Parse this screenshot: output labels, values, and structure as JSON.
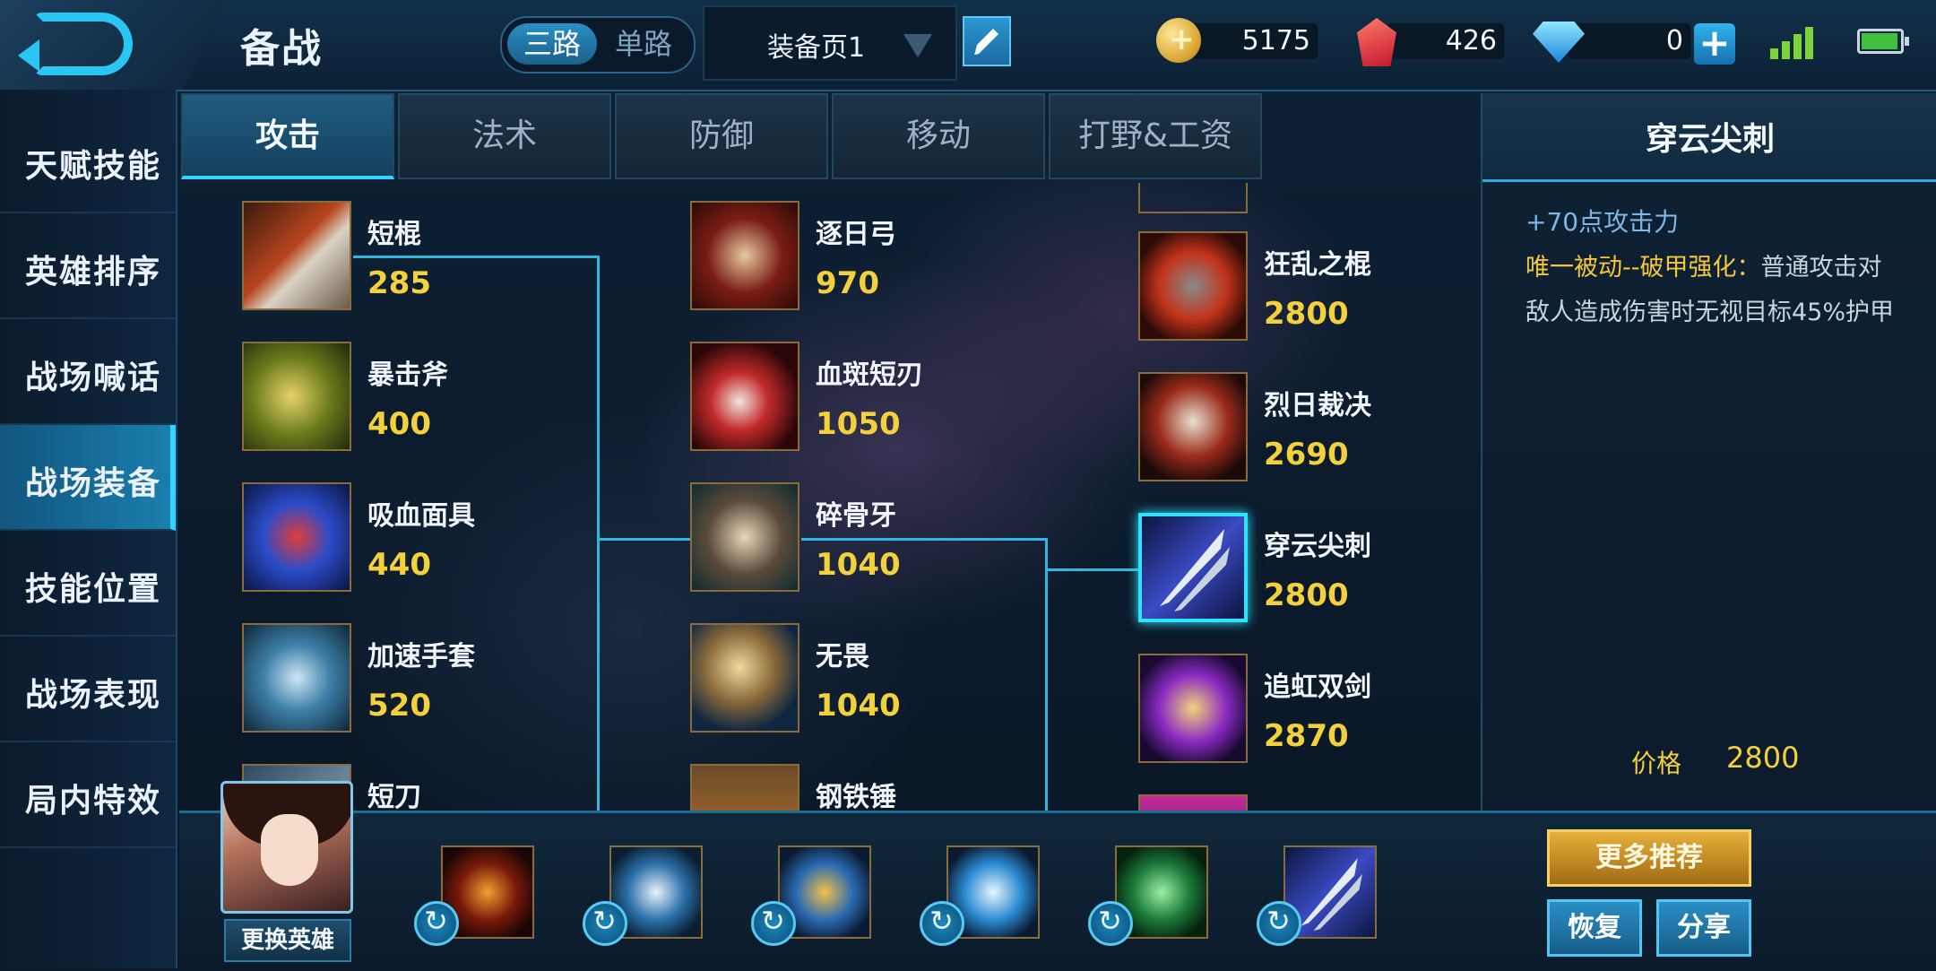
{
  "header": {
    "title": "备战",
    "mode_on": "三路",
    "mode_off": "单路",
    "equip_page": "装备页1",
    "gold": "5175",
    "crystal": "426",
    "diamond": "0"
  },
  "sidebar": {
    "items": [
      {
        "label": "天赋技能"
      },
      {
        "label": "英雄排序"
      },
      {
        "label": "战场喊话"
      },
      {
        "label": "战场装备"
      },
      {
        "label": "技能位置"
      },
      {
        "label": "战场表现"
      },
      {
        "label": "局内特效"
      }
    ],
    "active_index": 3
  },
  "tabs": [
    {
      "label": "攻击"
    },
    {
      "label": "法术"
    },
    {
      "label": "防御"
    },
    {
      "label": "移动"
    },
    {
      "label": "打野&工资"
    }
  ],
  "tree": {
    "col1": [
      {
        "name": "短棍",
        "price": "285"
      },
      {
        "name": "暴击斧",
        "price": "400"
      },
      {
        "name": "吸血面具",
        "price": "440"
      },
      {
        "name": "加速手套",
        "price": "520"
      },
      {
        "name": "短刀",
        "price": ""
      }
    ],
    "col2": [
      {
        "name": "逐日弓",
        "price": "970"
      },
      {
        "name": "血斑短刃",
        "price": "1050"
      },
      {
        "name": "碎骨牙",
        "price": "1040"
      },
      {
        "name": "无畏",
        "price": "1040"
      },
      {
        "name": "钢铁锤",
        "price": ""
      }
    ],
    "col3": [
      {
        "name": "狂乱之棍",
        "price": "2800"
      },
      {
        "name": "烈日裁决",
        "price": "2690"
      },
      {
        "name": "穿云尖刺",
        "price": "2800"
      },
      {
        "name": "追虹双剑",
        "price": "2870"
      }
    ]
  },
  "detail": {
    "title": "穿云尖刺",
    "stat": "+70点攻击力",
    "passive_label": "唯一被动--破甲强化：",
    "passive_text": "普通攻击对敌人造成伤害时无视目标45%护甲",
    "price_label": "价格",
    "price_value": "2800"
  },
  "bottom": {
    "change_hero": "更换英雄",
    "more": "更多推荐",
    "restore": "恢复",
    "share": "分享"
  },
  "colors": {
    "accent": "#35d2ff",
    "price": "#f3d13c",
    "highlight": "#f5c63a"
  }
}
